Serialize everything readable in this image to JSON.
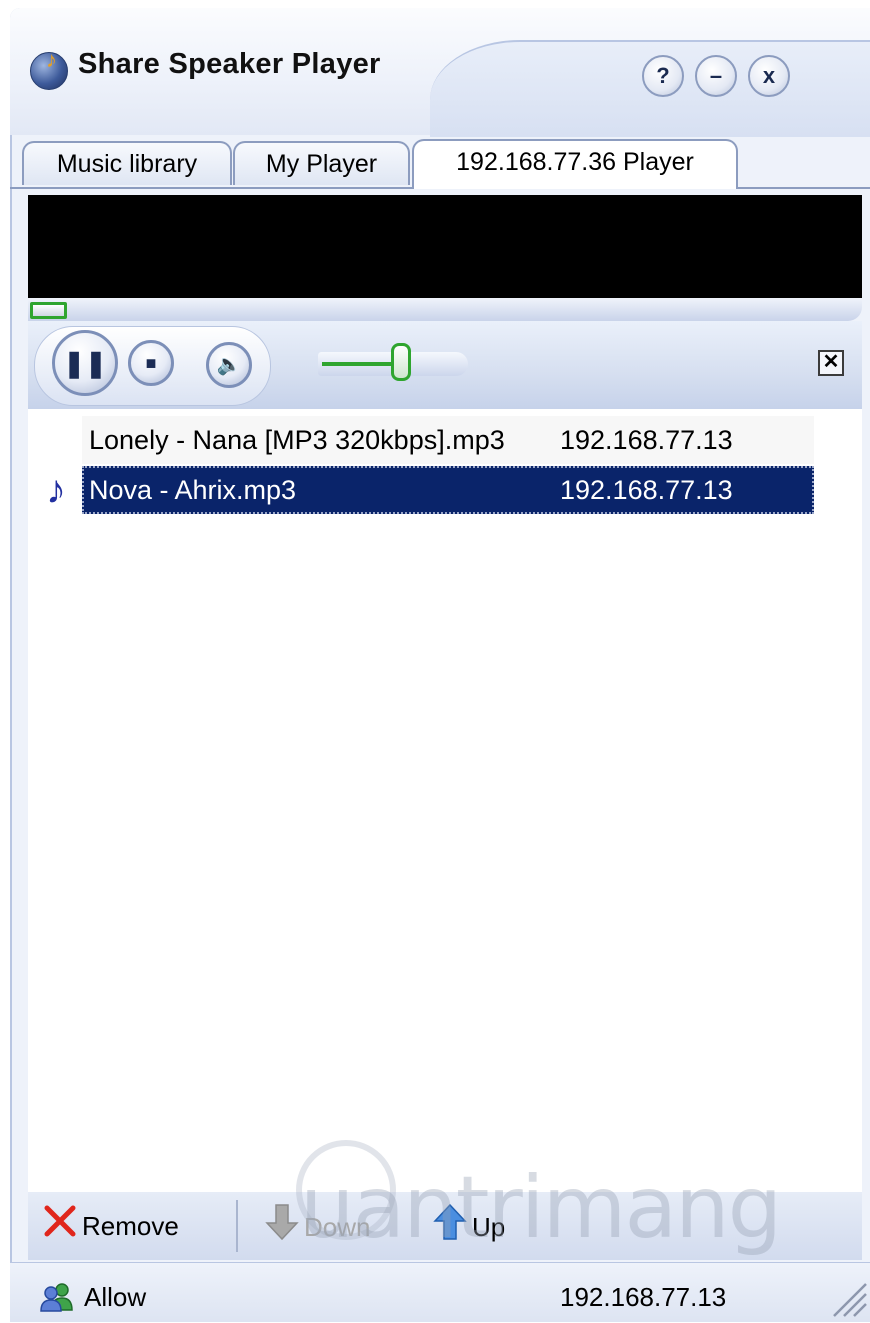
{
  "window": {
    "title": "Share Speaker Player",
    "buttons": {
      "help": "?",
      "minimize": "–",
      "close": "x"
    }
  },
  "tabs": [
    {
      "label": "Music library",
      "active": false
    },
    {
      "label": "My Player",
      "active": false
    },
    {
      "label": "192.168.77.36 Player",
      "active": true
    }
  ],
  "player": {
    "seek_fraction": 0.0,
    "volume_fraction": 0.55,
    "close_playlist_label": "✕"
  },
  "playlist": {
    "rows": [
      {
        "name": "Lonely - Nana [MP3 320kbps].mp3",
        "host": "192.168.77.13",
        "selected": false,
        "playing": false
      },
      {
        "name": "Nova - Ahrix.mp3",
        "host": "192.168.77.13",
        "selected": true,
        "playing": true
      }
    ]
  },
  "toolbar": {
    "remove_label": "Remove",
    "down_label": "Down",
    "up_label": "Up"
  },
  "watermark": {
    "text": "uantrimang"
  },
  "status": {
    "label": "Allow",
    "ip": "192.168.77.13"
  },
  "colors": {
    "selection": "#0a246a",
    "accent_green": "#2fa52f",
    "frame_blue": "#8c9cbf"
  }
}
